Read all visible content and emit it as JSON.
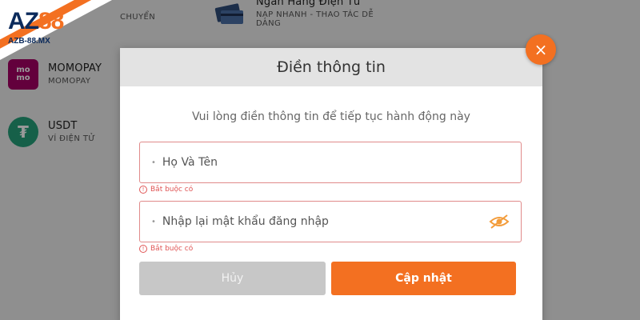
{
  "brand": {
    "name_prefix": "AZ",
    "name_suffix": "88",
    "domain": "AZB-88.MX"
  },
  "payment_methods": [
    {
      "title": "",
      "subtitle": "CHUYỂN"
    },
    {
      "title": "Ngân Hàng Điện Tử",
      "subtitle": "NẠP NHANH - THAO TÁC DỄ DÀNG"
    },
    {
      "title": "MOMOPAY",
      "subtitle": "MOMOPAY",
      "logo_text_top": "mo",
      "logo_text_bottom": "mo"
    },
    {
      "title": "USDT",
      "subtitle": "VÍ ĐIỆN TỬ",
      "logo_text": "₮"
    }
  ],
  "modal": {
    "title": "Điền thông tin",
    "close_symbol": "×",
    "description": "Vui lòng điền thông tin để tiếp tục hành động này",
    "fields": [
      {
        "placeholder": "Họ Và Tên",
        "error": "Bắt buộc có"
      },
      {
        "placeholder": "Nhập lại mật khẩu đăng nhập",
        "error": "Bắt buộc có"
      }
    ],
    "cancel_label": "Hủy",
    "submit_label": "Cập nhật"
  },
  "colors": {
    "accent": "#f37021",
    "error": "#e05555",
    "brand_navy": "#0b2a5b"
  }
}
